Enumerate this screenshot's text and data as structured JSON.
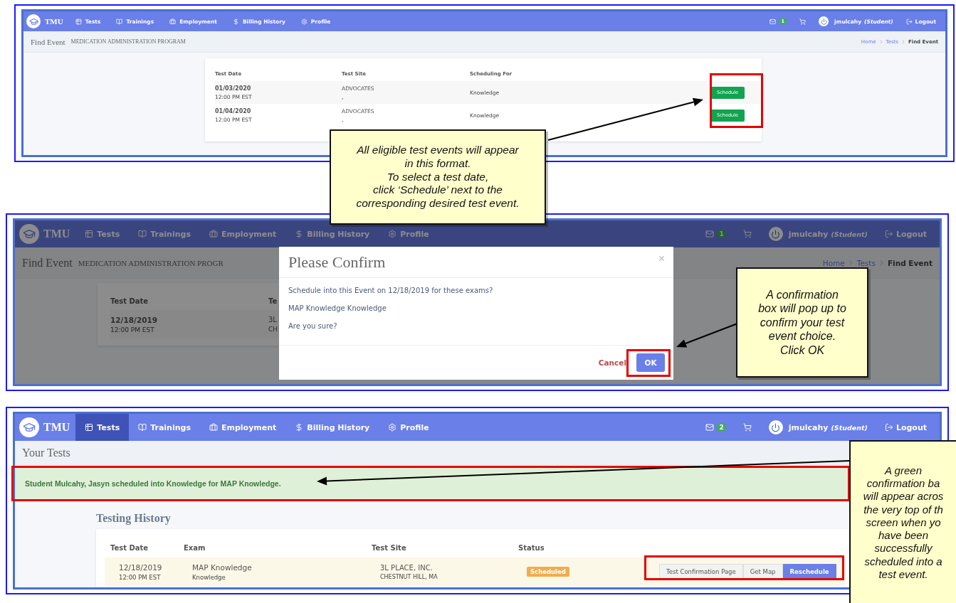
{
  "screenshots": [
    {
      "kind": "find_event",
      "dimmed": false,
      "navbar": {
        "brand": "TMU",
        "items": [
          {
            "label": "Tests",
            "selected": false
          },
          {
            "label": "Trainings",
            "selected": false
          },
          {
            "label": "Employment",
            "selected": false
          },
          {
            "label": "Billing History",
            "selected": false
          },
          {
            "label": "Profile",
            "selected": false
          }
        ],
        "mail_count": "1",
        "user": "jmulcahy",
        "role": "(Student)",
        "logout": "Logout"
      },
      "header": {
        "title": "Find Event",
        "subtitle": "MEDICATION ADMINISTRATION PROGRAM",
        "breadcrumb": [
          {
            "label": "Home",
            "current": false
          },
          {
            "label": "Tests",
            "current": false
          },
          {
            "label": "Find Event",
            "current": true
          }
        ]
      },
      "table": {
        "columns": [
          "Test Date",
          "Test Site",
          "Scheduling For"
        ],
        "rows": [
          {
            "date": "01/03/2020",
            "time": "12:00 PM EST",
            "site": "ADVOCATES",
            "site_detail": ",",
            "scheduling_for": "Knowledge",
            "action": "Schedule"
          },
          {
            "date": "01/04/2020",
            "time": "12:00 PM EST",
            "site": "ADVOCATES",
            "site_detail": ",",
            "scheduling_for": "Knowledge",
            "action": "Schedule"
          }
        ]
      }
    },
    {
      "kind": "find_event",
      "dimmed": true,
      "navbar": {
        "brand": "TMU",
        "items": [
          {
            "label": "Tests",
            "selected": false
          },
          {
            "label": "Trainings",
            "selected": false
          },
          {
            "label": "Employment",
            "selected": false
          },
          {
            "label": "Billing History",
            "selected": false
          },
          {
            "label": "Profile",
            "selected": false
          }
        ],
        "mail_count": "1",
        "user": "jmulcahy",
        "role": "(Student)",
        "logout": "Logout"
      },
      "header": {
        "title": "Find Event",
        "subtitle": "MEDICATION ADMINISTRATION PROGR",
        "breadcrumb": [
          {
            "label": "Home",
            "current": false
          },
          {
            "label": "Tests",
            "current": false
          },
          {
            "label": "Find Event",
            "current": true
          }
        ]
      },
      "table": {
        "columns": [
          "Test Date",
          "Te"
        ],
        "rows": [
          {
            "date": "12/18/2019",
            "time": "12:00 PM EST",
            "site": "3L",
            "site_detail": "CH"
          }
        ]
      },
      "modal": {
        "title": "Please Confirm",
        "close": "×",
        "lines": [
          "Schedule into this Event on 12/18/2019 for these exams?",
          "MAP Knowledge Knowledge",
          "Are you sure?"
        ],
        "cancel": "Cancel",
        "ok": "OK"
      }
    },
    {
      "kind": "your_tests",
      "dimmed": false,
      "navbar": {
        "brand": "TMU",
        "items": [
          {
            "label": "Tests",
            "selected": true
          },
          {
            "label": "Trainings",
            "selected": false
          },
          {
            "label": "Employment",
            "selected": false
          },
          {
            "label": "Billing History",
            "selected": false
          },
          {
            "label": "Profile",
            "selected": false
          }
        ],
        "mail_count": "2",
        "user": "jmulcahy",
        "role": "(Student)",
        "logout": "Logout"
      },
      "header": {
        "title": "Your Tests"
      },
      "alert": "Student Mulcahy, Jasyn scheduled into Knowledge for MAP Knowledge.",
      "section_title": "Testing History",
      "table": {
        "columns": [
          "Test Date",
          "Exam",
          "Test Site",
          "Status"
        ],
        "rows": [
          {
            "date": "12/18/2019",
            "time": "12:00 PM EST",
            "exam": "MAP Knowledge",
            "exam_detail": "Knowledge",
            "site": "3L PLACE, INC.",
            "site_detail": "CHESTNUT HILL, MA",
            "status": "Scheduled",
            "actions": [
              {
                "label": "Test Confirmation Page",
                "kind": "default"
              },
              {
                "label": "Get Map",
                "kind": "default"
              },
              {
                "label": "Reschedule",
                "kind": "primary"
              }
            ]
          }
        ]
      }
    }
  ],
  "callouts": [
    {
      "lines": [
        "All eligible test events will appear",
        "in this format.",
        "To select a test date,",
        "click ‘Schedule’ next to the",
        "corresponding desired test event."
      ]
    },
    {
      "lines": [
        "A confirmation",
        "box will pop up to",
        "confirm your test",
        "event choice.",
        "Click OK"
      ]
    },
    {
      "lines": [
        "A green",
        "confirmation ba",
        "will appear acros",
        "the very top of th",
        "screen when yo",
        "have been",
        "successfully",
        "scheduled into a",
        "test event."
      ]
    }
  ]
}
